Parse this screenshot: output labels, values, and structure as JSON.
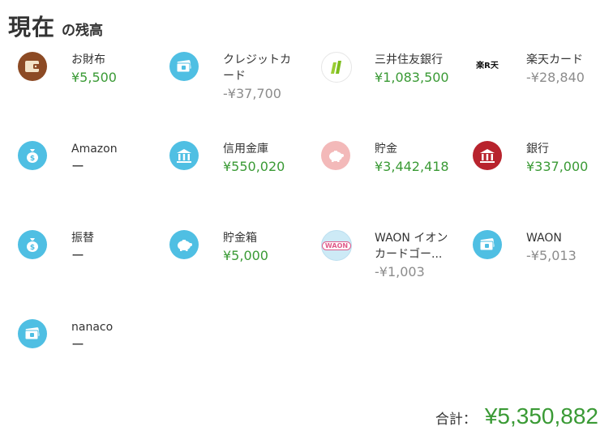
{
  "header": {
    "title": "現在",
    "subtitle": "の残高"
  },
  "accounts": [
    {
      "name": "お財布",
      "balance": "¥5,500",
      "status": "pos",
      "icon": "wallet-icon"
    },
    {
      "name": "クレジットカード",
      "balance": "-¥37,700",
      "status": "neg",
      "icon": "card-icon"
    },
    {
      "name": "三井住友銀行",
      "balance": "¥1,083,500",
      "status": "pos",
      "icon": "smbc-logo-icon"
    },
    {
      "name": "楽天カード",
      "balance": "-¥28,840",
      "status": "neg",
      "icon": "rakuten-logo-icon",
      "logo_text": "楽R天"
    },
    {
      "name": "Amazon",
      "balance": "ー",
      "status": "none",
      "icon": "money-bag-icon"
    },
    {
      "name": "信用金庫",
      "balance": "¥550,020",
      "status": "pos",
      "icon": "bank-icon"
    },
    {
      "name": "貯金",
      "balance": "¥3,442,418",
      "status": "pos",
      "icon": "piggy-bank-icon"
    },
    {
      "name": "銀行",
      "balance": "¥337,000",
      "status": "pos",
      "icon": "bank-icon"
    },
    {
      "name": "振替",
      "balance": "ー",
      "status": "none",
      "icon": "money-bag-icon"
    },
    {
      "name": "貯金箱",
      "balance": "¥5,000",
      "status": "pos",
      "icon": "piggy-bank-icon"
    },
    {
      "name": "WAON イオンカードゴー...",
      "balance": "-¥1,003",
      "status": "neg",
      "icon": "waon-logo-icon",
      "logo_text": "WAON"
    },
    {
      "name": "WAON",
      "balance": "-¥5,013",
      "status": "neg",
      "icon": "card-icon"
    },
    {
      "name": "nanaco",
      "balance": "ー",
      "status": "none",
      "icon": "card-icon"
    }
  ],
  "total": {
    "label": "合計：",
    "value": "¥5,350,882"
  },
  "colors": {
    "accent_green": "#3a9a35",
    "negative_gray": "#8c8c8c",
    "icon_blue": "#4fbfe3"
  }
}
